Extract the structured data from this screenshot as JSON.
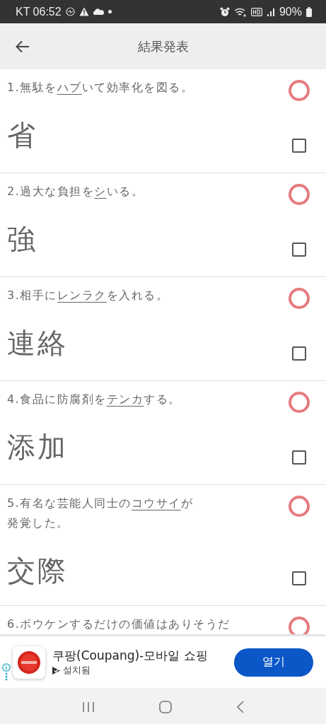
{
  "status_bar": {
    "carrier_time": "KT 06:52",
    "battery": "90%"
  },
  "header": {
    "title": "結果発表"
  },
  "questions": [
    {
      "number": "1.",
      "before": "無駄を",
      "underlined": "ハブ",
      "after": "いて効率化を図る。",
      "answer": "省",
      "correct": true,
      "checked": false
    },
    {
      "number": "2.",
      "before": "過大な負担を",
      "underlined": "シ",
      "after": "いる。",
      "answer": "強",
      "correct": true,
      "checked": false
    },
    {
      "number": "3.",
      "before": "相手に",
      "underlined": "レンラク",
      "after": "を入れる。",
      "answer": "連絡",
      "correct": true,
      "checked": false
    },
    {
      "number": "4.",
      "before": "食品に防腐剤を",
      "underlined": "テンカ",
      "after": "する。",
      "answer": "添加",
      "correct": true,
      "checked": false
    },
    {
      "number": "5.",
      "before": "有名な芸能人同士の",
      "underlined": "コウサイ",
      "after": "が",
      "second_line": "発覚した。",
      "answer": "交際",
      "correct": true,
      "checked": false
    },
    {
      "number": "6.",
      "before": "ボウケンするだけの価値はありそうだ",
      "correct": true
    }
  ],
  "ad": {
    "title": "쿠팡(Coupang)-모바일 쇼핑",
    "subtitle": "설치됨",
    "button": "열기"
  }
}
